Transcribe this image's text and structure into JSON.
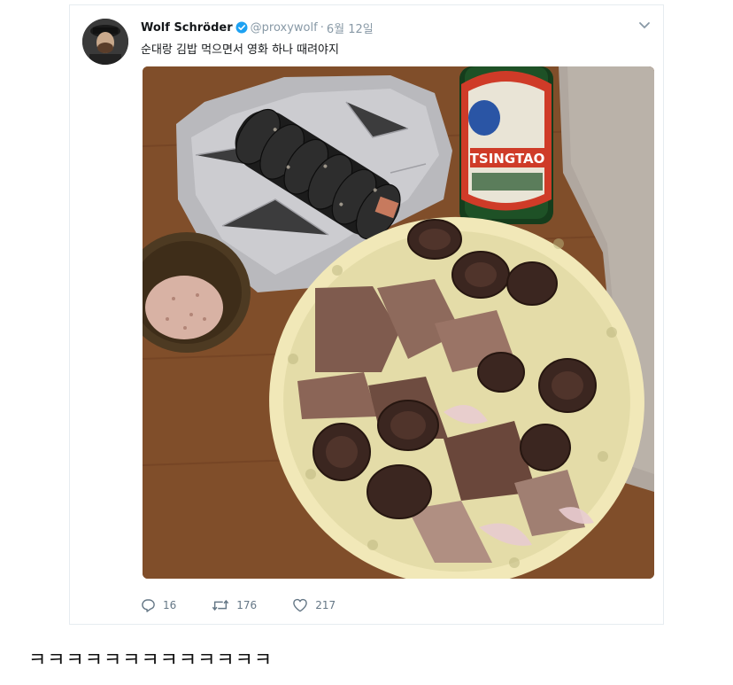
{
  "tweet": {
    "display_name": "Wolf Schröder",
    "handle": "@proxywolf",
    "separator": "·",
    "date": "6월 12일",
    "text": "순대랑 김밥 먹으면서 영화 하나 때려야지",
    "photo_label": "TSINGTAO",
    "actions": {
      "reply_count": "16",
      "retweet_count": "176",
      "like_count": "217"
    }
  },
  "comment": {
    "text": "ㅋㅋㅋㅋㅋㅋㅋㅋㅋㅋㅋㅋㅋ"
  },
  "colors": {
    "verified": "#1da1f2",
    "muted": "#8899a6",
    "action": "#657786"
  },
  "icons": {
    "verified": "verified-badge-icon",
    "menu": "chevron-down-icon",
    "reply": "reply-icon",
    "retweet": "retweet-icon",
    "like": "heart-icon"
  }
}
